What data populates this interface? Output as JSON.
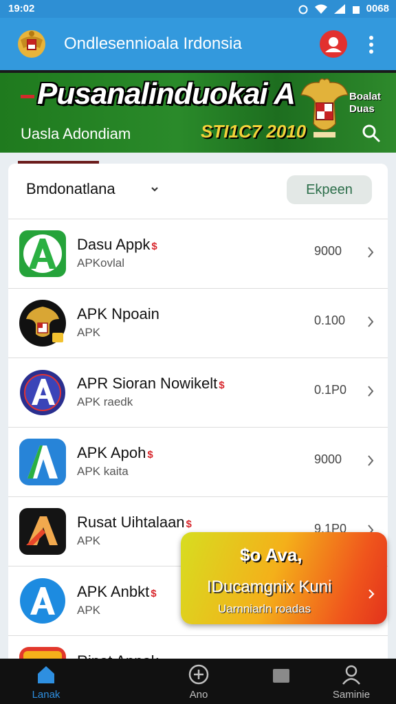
{
  "status": {
    "time": "19:02",
    "battery": "0068"
  },
  "header": {
    "title": "Ondlesennioala Irdonsia"
  },
  "banner": {
    "headline": "Pusanalinduokai A",
    "subtitle": "Uasla Adondiam",
    "year": "STI1C7 2010",
    "side_top": "Boalat",
    "side_bottom": "Duas"
  },
  "list_header": {
    "filter": "Bmdonatlana",
    "action": "Ekpeen"
  },
  "items": [
    {
      "name": "Dasu Appk",
      "badge": "$",
      "subtitle": "APKovlal",
      "value": "9000",
      "icon_name": "green-a-icon"
    },
    {
      "name": "APK Npoain",
      "badge": "",
      "subtitle": "APK",
      "value": "0.100",
      "icon_name": "garuda-icon"
    },
    {
      "name": "APR Sioran Nowikelt",
      "badge": "$",
      "subtitle": "APK raedk",
      "value": "0.1P0",
      "icon_name": "blue-circle-a-icon"
    },
    {
      "name": "APK Apoh",
      "badge": "$",
      "subtitle": "APK kaita",
      "value": "9000",
      "icon_name": "blue-green-a-icon"
    },
    {
      "name": "Rusat Uihtalaan",
      "badge": "$",
      "subtitle": "APK",
      "value": "9.1P0",
      "icon_name": "dark-a-icon"
    },
    {
      "name": "APK Anbkt",
      "badge": "$",
      "subtitle": "APK",
      "value": "",
      "icon_name": "light-blue-a-icon"
    },
    {
      "name": "Rinat Annak",
      "badge": "",
      "subtitle": "",
      "value": "",
      "icon_name": "red-a-icon"
    }
  ],
  "promo": {
    "line1": "$o Ava,",
    "line2": "IDucamgnix Kuni",
    "line3": "Uarnniarln roadas"
  },
  "nav": [
    {
      "label": "Lanak",
      "icon": "home-icon",
      "active": true
    },
    {
      "label": "Ano",
      "icon": "add-circle-icon",
      "active": false
    },
    {
      "label": "",
      "icon": "square-icon",
      "active": false
    },
    {
      "label": "Saminie",
      "icon": "profile-icon",
      "active": false
    }
  ],
  "colors": {
    "primary": "#3399dd",
    "banner_green": "#2a8a2a",
    "accent_red": "#d8262c",
    "promo_orange": "#f4b01a"
  }
}
